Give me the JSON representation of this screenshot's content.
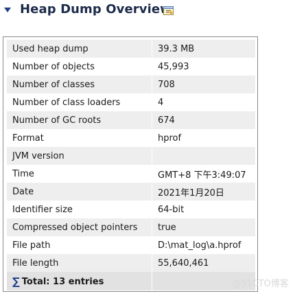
{
  "header": {
    "title": "Heap Dump Overview"
  },
  "rows": [
    {
      "name": "Used heap dump",
      "value": "39.3 MB"
    },
    {
      "name": "Number of objects",
      "value": "45,993"
    },
    {
      "name": "Number of classes",
      "value": "708"
    },
    {
      "name": "Number of class loaders",
      "value": "4"
    },
    {
      "name": "Number of GC roots",
      "value": "674"
    },
    {
      "name": "Format",
      "value": "hprof"
    },
    {
      "name": "JVM version",
      "value": ""
    },
    {
      "name": "Time",
      "value": "GMT+8 下午3:49:07"
    },
    {
      "name": "Date",
      "value": "2021年1月20日"
    },
    {
      "name": "Identifier size",
      "value": "64-bit"
    },
    {
      "name": "Compressed object pointers",
      "value": "true"
    },
    {
      "name": "File path",
      "value": "D:\\mat_log\\a.hprof"
    },
    {
      "name": "File length",
      "value": "55,640,461"
    }
  ],
  "summary": {
    "label": "Total: 13 entries"
  },
  "watermark": "@51CTO博客"
}
